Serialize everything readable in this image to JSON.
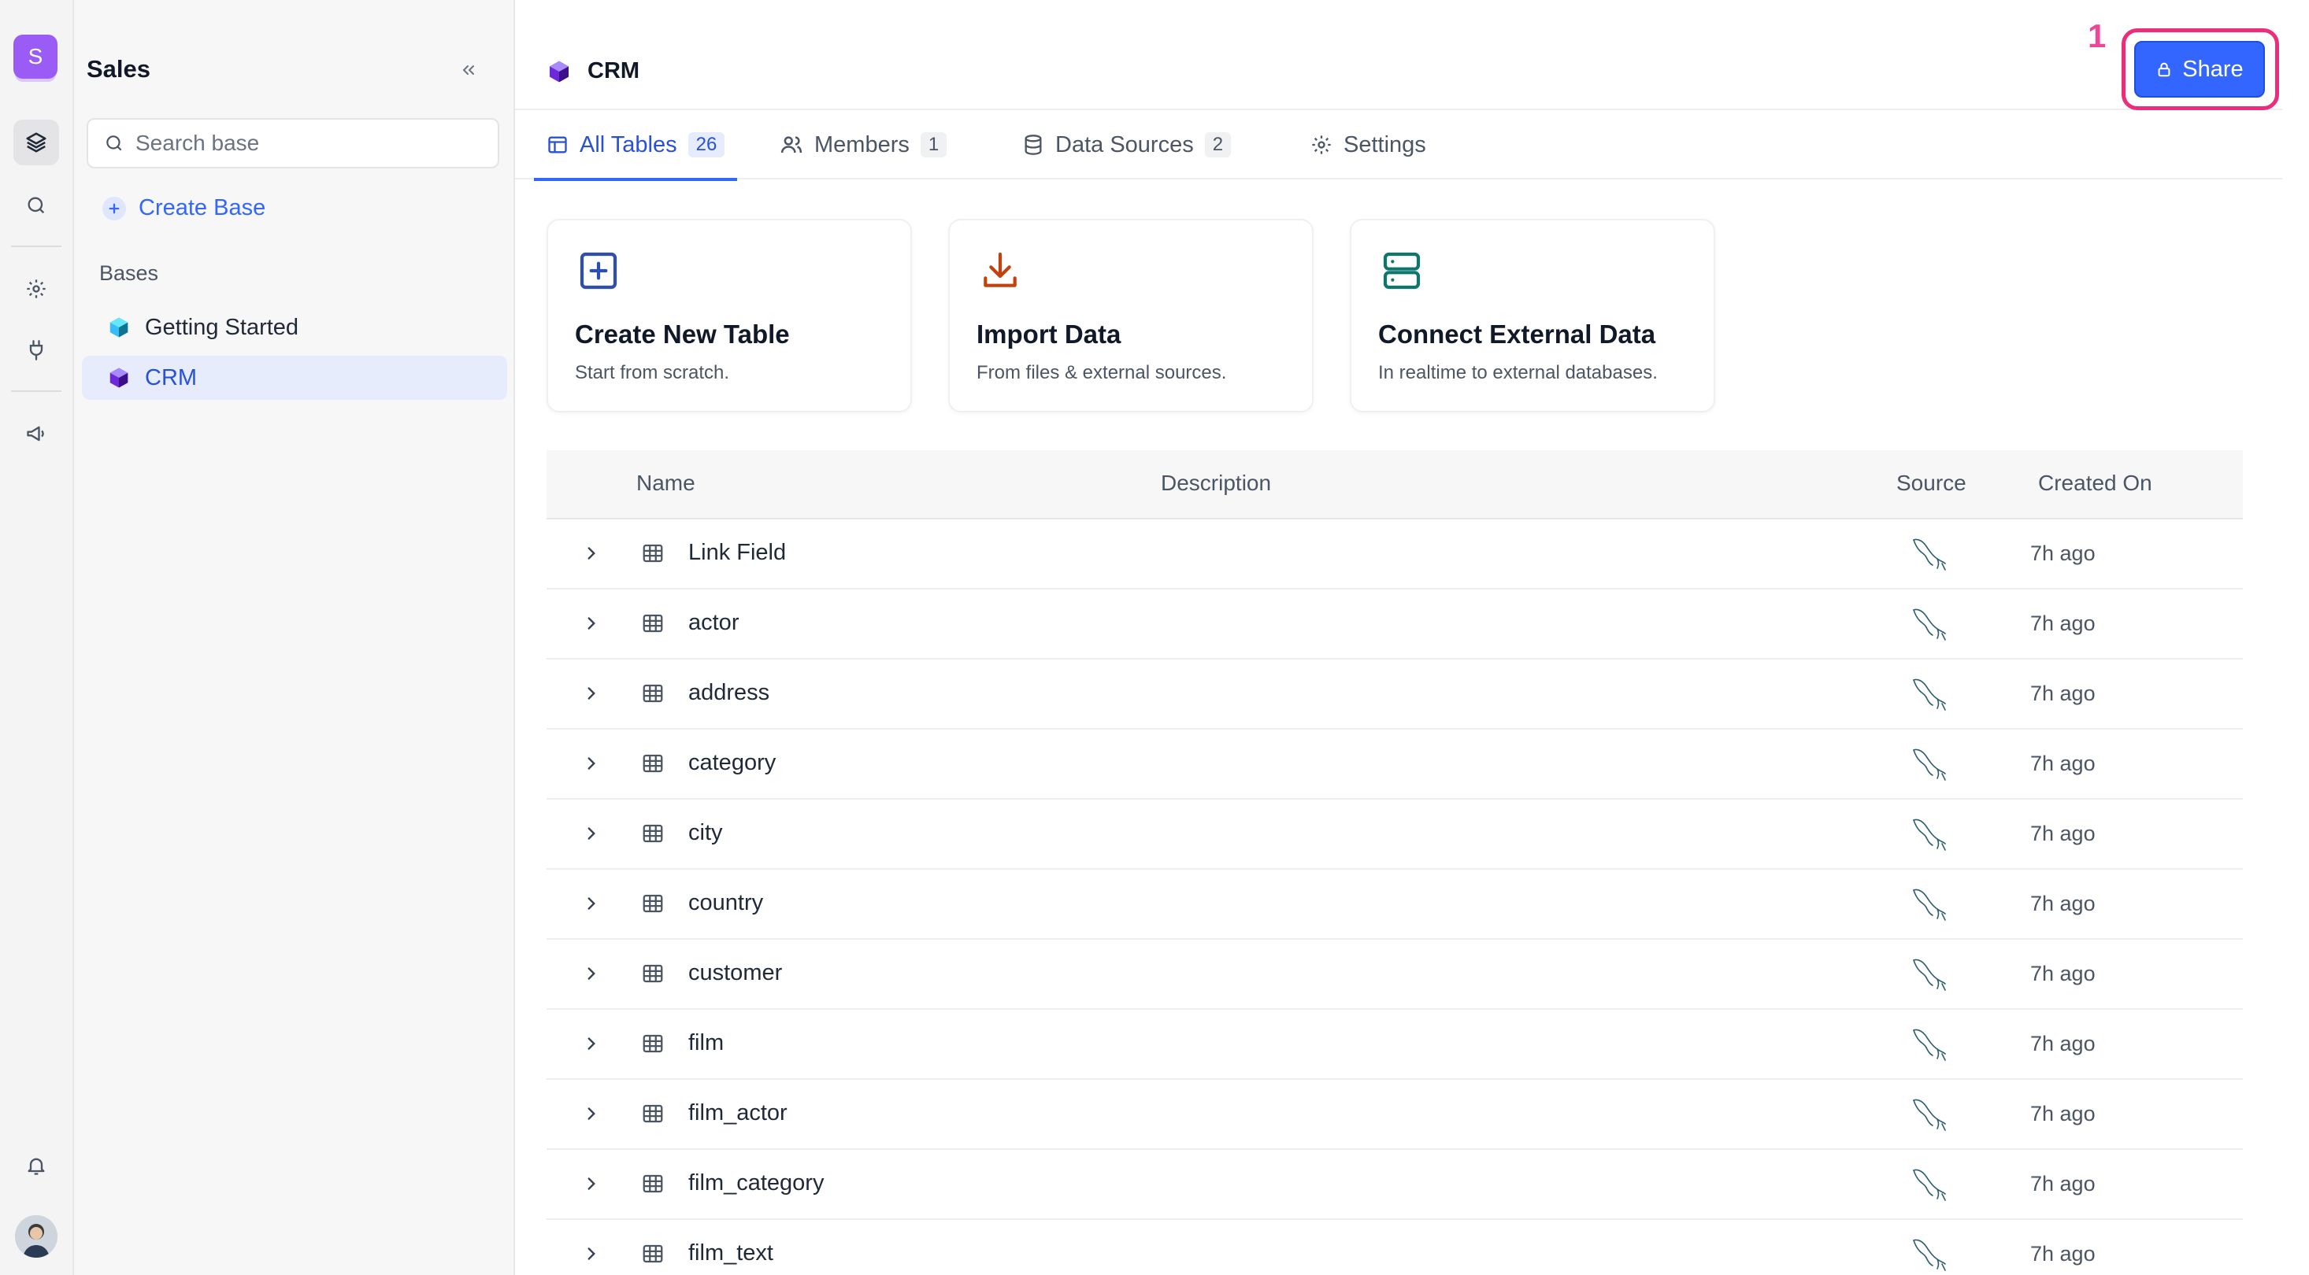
{
  "workspace": {
    "initial": "S",
    "title": "Sales",
    "search_placeholder": "Search base",
    "create_base_label": "Create Base",
    "bases_label": "Bases"
  },
  "bases": [
    {
      "label": "Getting Started",
      "color": "#38bdf8"
    },
    {
      "label": "CRM",
      "color": "#6d28d9"
    }
  ],
  "header": {
    "title": "CRM",
    "share_label": "Share",
    "annotation": "1"
  },
  "tabs": [
    {
      "label": "All Tables",
      "count": "26"
    },
    {
      "label": "Members",
      "count": "1"
    },
    {
      "label": "Data Sources",
      "count": "2"
    },
    {
      "label": "Settings",
      "count": ""
    }
  ],
  "cards": [
    {
      "title": "Create New Table",
      "subtitle": "Start from scratch."
    },
    {
      "title": "Import Data",
      "subtitle": "From files & external sources."
    },
    {
      "title": "Connect External Data",
      "subtitle": "In realtime to external databases."
    }
  ],
  "table": {
    "columns": {
      "name": "Name",
      "description": "Description",
      "source": "Source",
      "created": "Created On"
    },
    "rows": [
      {
        "name": "Link Field",
        "created": "7h ago"
      },
      {
        "name": "actor",
        "created": "7h ago"
      },
      {
        "name": "address",
        "created": "7h ago"
      },
      {
        "name": "category",
        "created": "7h ago"
      },
      {
        "name": "city",
        "created": "7h ago"
      },
      {
        "name": "country",
        "created": "7h ago"
      },
      {
        "name": "customer",
        "created": "7h ago"
      },
      {
        "name": "film",
        "created": "7h ago"
      },
      {
        "name": "film_actor",
        "created": "7h ago"
      },
      {
        "name": "film_category",
        "created": "7h ago"
      },
      {
        "name": "film_text",
        "created": "7h ago"
      }
    ]
  },
  "colors": {
    "accent": "#3366ff",
    "annotation": "#ec2d7a"
  }
}
